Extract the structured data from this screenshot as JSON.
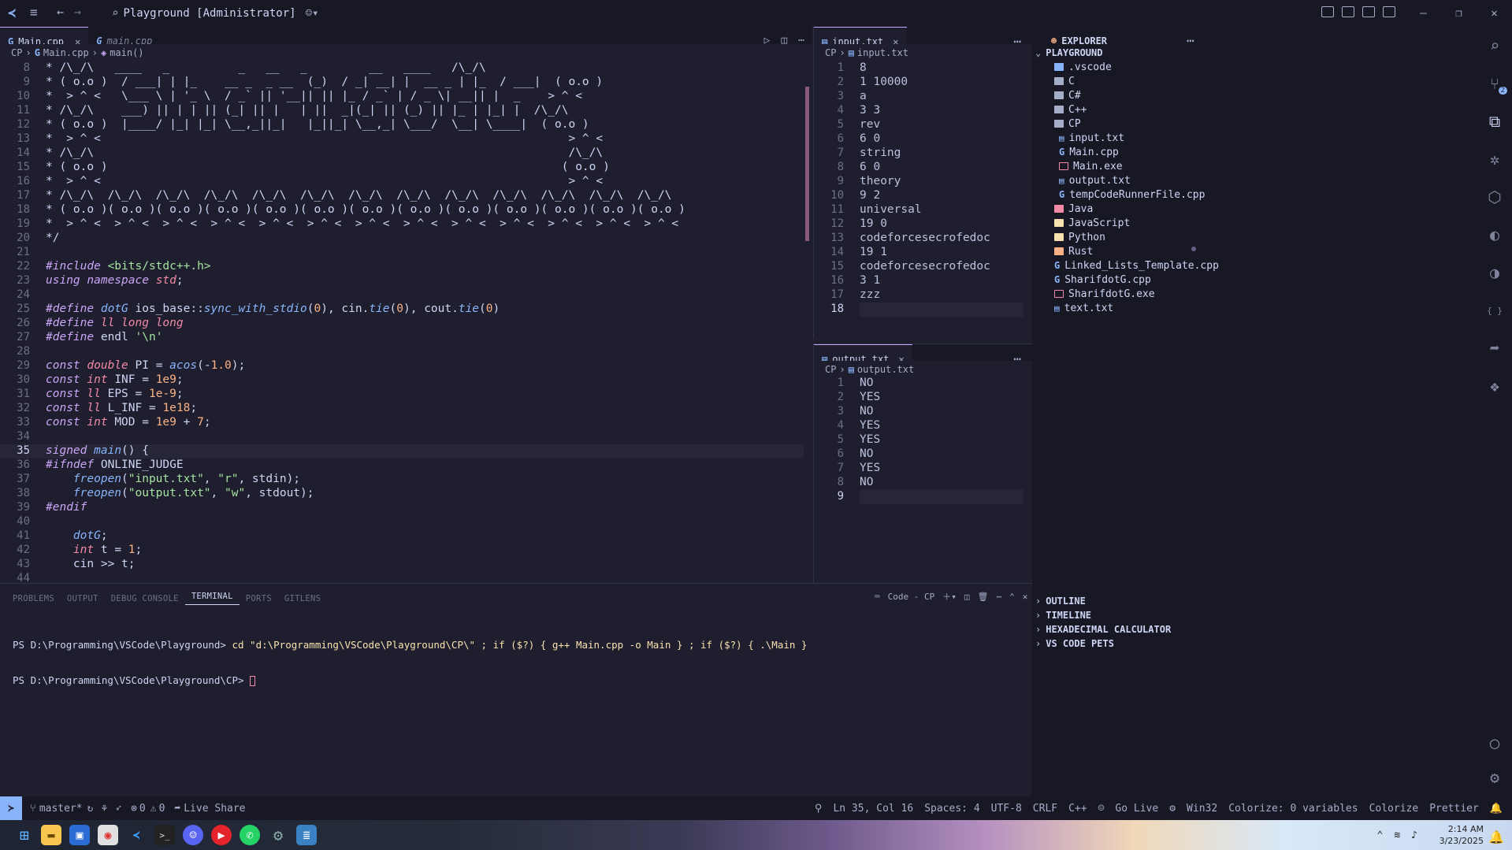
{
  "titlebar": {
    "search": "Playground [Administrator]"
  },
  "editor_tabs": [
    {
      "label": "Main.cpp",
      "active": true
    },
    {
      "label": "main.cpp",
      "active": false
    }
  ],
  "editor_crumb": {
    "root": "CP",
    "file": "Main.cpp",
    "symbol": "main()"
  },
  "editor_lines": [
    {
      "n": "8",
      "c": "* /\\_/\\   ____   _          _   __   _         __   ____   /\\_/\\"
    },
    {
      "n": "9",
      "c": "* ( o.o )  / ___| | |_    __ _  _ __  (_)  / _| __| |  __ _ | |_  / ___|  ( o.o )"
    },
    {
      "n": "10",
      "c": "*  > ^ <   \\___ \\ | '_ \\  / _` || '__|| || |_ / _` | / _ \\| __|| |  _    > ^ <"
    },
    {
      "n": "11",
      "c": "* /\\_/\\    ___) || | | || (_| || |   | ||  _|(_| || (_) || |_ | |_| |  /\\_/\\"
    },
    {
      "n": "12",
      "c": "* ( o.o )  |____/ |_| |_| \\__,_||_|   |_||_| \\__,_| \\___/  \\__| \\____|  ( o.o )"
    },
    {
      "n": "13",
      "c": "*  > ^ <                                                                    > ^ <"
    },
    {
      "n": "14",
      "c": "* /\\_/\\                                                                     /\\_/\\"
    },
    {
      "n": "15",
      "c": "* ( o.o )                                                                  ( o.o )"
    },
    {
      "n": "16",
      "c": "*  > ^ <                                                                    > ^ <"
    },
    {
      "n": "17",
      "c": "* /\\_/\\  /\\_/\\  /\\_/\\  /\\_/\\  /\\_/\\  /\\_/\\  /\\_/\\  /\\_/\\  /\\_/\\  /\\_/\\  /\\_/\\  /\\_/\\  /\\_/\\"
    },
    {
      "n": "18",
      "c": "* ( o.o )( o.o )( o.o )( o.o )( o.o )( o.o )( o.o )( o.o )( o.o )( o.o )( o.o )( o.o )( o.o )"
    },
    {
      "n": "19",
      "c": "*  > ^ <  > ^ <  > ^ <  > ^ <  > ^ <  > ^ <  > ^ <  > ^ <  > ^ <  > ^ <  > ^ <  > ^ <  > ^ <"
    },
    {
      "n": "20",
      "c": "*/"
    },
    {
      "n": "21",
      "c": ""
    },
    {
      "n": "22",
      "c": "#include <bits/stdc++.h>"
    },
    {
      "n": "23",
      "c": "using namespace std;"
    },
    {
      "n": "24",
      "c": ""
    },
    {
      "n": "25",
      "c": "#define dotG ios_base::sync_with_stdio(0), cin.tie(0), cout.tie(0)"
    },
    {
      "n": "26",
      "c": "#define ll long long"
    },
    {
      "n": "27",
      "c": "#define endl '\\n'"
    },
    {
      "n": "28",
      "c": ""
    },
    {
      "n": "29",
      "c": "const double PI = acos(-1.0);"
    },
    {
      "n": "30",
      "c": "const int INF = 1e9;"
    },
    {
      "n": "31",
      "c": "const ll EPS = 1e-9;"
    },
    {
      "n": "32",
      "c": "const ll L_INF = 1e18;"
    },
    {
      "n": "33",
      "c": "const int MOD = 1e9 + 7;"
    },
    {
      "n": "34",
      "c": ""
    },
    {
      "n": "35",
      "c": "signed main() {"
    },
    {
      "n": "36",
      "c": "#ifndef ONLINE_JUDGE"
    },
    {
      "n": "37",
      "c": "    freopen(\"input.txt\", \"r\", stdin);"
    },
    {
      "n": "38",
      "c": "    freopen(\"output.txt\", \"w\", stdout);"
    },
    {
      "n": "39",
      "c": "#endif"
    },
    {
      "n": "40",
      "c": ""
    },
    {
      "n": "41",
      "c": "    dotG;"
    },
    {
      "n": "42",
      "c": "    int t = 1;"
    },
    {
      "n": "43",
      "c": "    cin >> t;"
    },
    {
      "n": "44",
      "c": ""
    }
  ],
  "input_pane": {
    "tab": "input.txt",
    "crumb_root": "CP",
    "crumb_file": "input.txt",
    "lines": [
      "8",
      "1 10000",
      "a",
      "3 3",
      "rev",
      "6 0",
      "string",
      "6 0",
      "theory",
      "9 2",
      "universal",
      "19 0",
      "codeforcesecrofedoc",
      "19 1",
      "codeforcesecrofedoc",
      "3 1",
      "zzz",
      ""
    ]
  },
  "output_pane": {
    "tab": "output.txt",
    "crumb_root": "CP",
    "crumb_file": "output.txt",
    "lines": [
      "NO",
      "YES",
      "NO",
      "YES",
      "YES",
      "NO",
      "YES",
      "NO",
      ""
    ]
  },
  "explorer": {
    "title": "EXPLORER",
    "root": "PLAYGROUND",
    "items": [
      {
        "label": ".vscode",
        "kind": "folder",
        "color": "#89b4fa",
        "indent": 1
      },
      {
        "label": "C",
        "kind": "folder",
        "color": "#a6adc8",
        "indent": 1
      },
      {
        "label": "C#",
        "kind": "folder",
        "color": "#a6adc8",
        "indent": 1
      },
      {
        "label": "C++",
        "kind": "folder",
        "color": "#a6adc8",
        "indent": 1
      },
      {
        "label": "CP",
        "kind": "folder-open",
        "color": "#a6adc8",
        "indent": 1
      },
      {
        "label": "input.txt",
        "kind": "file",
        "color": "#89b4fa",
        "indent": 2
      },
      {
        "label": "Main.cpp",
        "kind": "cpp",
        "color": "#89b4fa",
        "indent": 2
      },
      {
        "label": "Main.exe",
        "kind": "exe",
        "color": "#f38ba8",
        "indent": 2
      },
      {
        "label": "output.txt",
        "kind": "file",
        "color": "#89b4fa",
        "indent": 2
      },
      {
        "label": "tempCodeRunnerFile.cpp",
        "kind": "cpp",
        "color": "#89b4fa",
        "indent": 2
      },
      {
        "label": "Java",
        "kind": "folder",
        "color": "#f38ba8",
        "indent": 1
      },
      {
        "label": "JavaScript",
        "kind": "folder",
        "color": "#f9e2af",
        "indent": 1
      },
      {
        "label": "Python",
        "kind": "folder",
        "color": "#f9e2af",
        "indent": 1
      },
      {
        "label": "Rust",
        "kind": "folder",
        "color": "#fab387",
        "indent": 1
      },
      {
        "label": "Linked_Lists_Template.cpp",
        "kind": "cpp",
        "color": "#89b4fa",
        "indent": 1
      },
      {
        "label": "SharifdotG.cpp",
        "kind": "cpp",
        "color": "#89b4fa",
        "indent": 1
      },
      {
        "label": "SharifdotG.exe",
        "kind": "exe",
        "color": "#f38ba8",
        "indent": 1
      },
      {
        "label": "text.txt",
        "kind": "file",
        "color": "#89b4fa",
        "indent": 1
      }
    ],
    "sections": [
      "OUTLINE",
      "TIMELINE",
      "HEXADECIMAL CALCULATOR",
      "VS CODE PETS"
    ]
  },
  "panel": {
    "tabs": [
      "PROBLEMS",
      "OUTPUT",
      "DEBUG CONSOLE",
      "TERMINAL",
      "PORTS",
      "GITLENS"
    ],
    "active": "TERMINAL",
    "terminal_name": "Code - CP",
    "line1_prompt": "PS D:\\Programming\\VSCode\\Playground>",
    "line1_cmd": "cd \"d:\\Programming\\VSCode\\Playground\\CP\\\" ; if ($?) { g++ Main.cpp -o Main } ; if ($?) { .\\Main }",
    "line2_prompt": "PS D:\\Programming\\VSCode\\Playground\\CP>"
  },
  "status": {
    "branch": "master*",
    "errors": "0",
    "warnings": "0",
    "liveshare": "Live Share",
    "position": "Ln 35, Col 16",
    "spaces": "Spaces: 4",
    "encoding": "UTF-8",
    "eol": "CRLF",
    "lang": "C++",
    "golive": "Go Live",
    "platform": "Win32",
    "colorize": "Colorize: 0 variables",
    "colorize2": "Colorize",
    "prettier": "Prettier"
  },
  "taskbar": {
    "time": "2:14 AM",
    "date": "3/23/2025"
  },
  "badge": "2"
}
